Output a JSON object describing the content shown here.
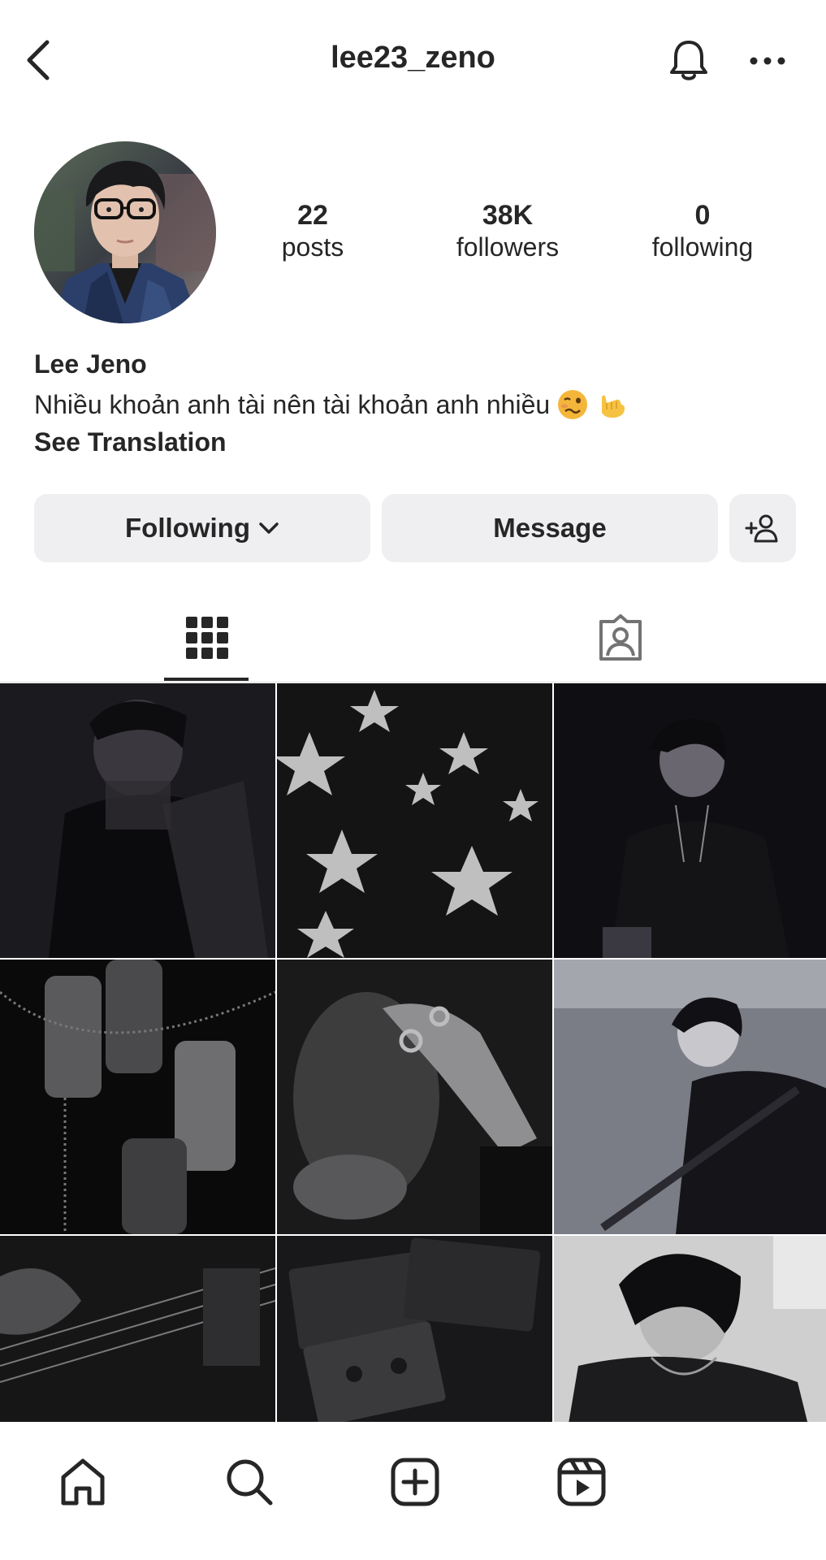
{
  "header": {
    "username": "lee23_zeno"
  },
  "profile": {
    "stats": [
      {
        "value": "22",
        "label": "posts"
      },
      {
        "value": "38K",
        "label": "followers"
      },
      {
        "value": "0",
        "label": "following"
      }
    ],
    "name": "Lee Jeno",
    "bio": "Nhiều khoản anh tài nên tài khoản anh nhiều",
    "see_translation": "See Translation"
  },
  "actions": {
    "following_label": "Following",
    "message_label": "Message"
  },
  "tabs": {
    "grid_icon": "grid-icon",
    "tagged_icon": "tagged-icon"
  },
  "posts": [
    {
      "description_icon": "photo"
    },
    {
      "description_icon": "photo"
    },
    {
      "description_icon": "photo"
    },
    {
      "description_icon": "photo"
    },
    {
      "description_icon": "photo"
    },
    {
      "description_icon": "photo"
    },
    {
      "description_icon": "photo"
    },
    {
      "description_icon": "photo"
    },
    {
      "description_icon": "photo"
    }
  ],
  "bottom_nav": [
    "home-icon",
    "search-icon",
    "create-icon",
    "reels-icon"
  ]
}
